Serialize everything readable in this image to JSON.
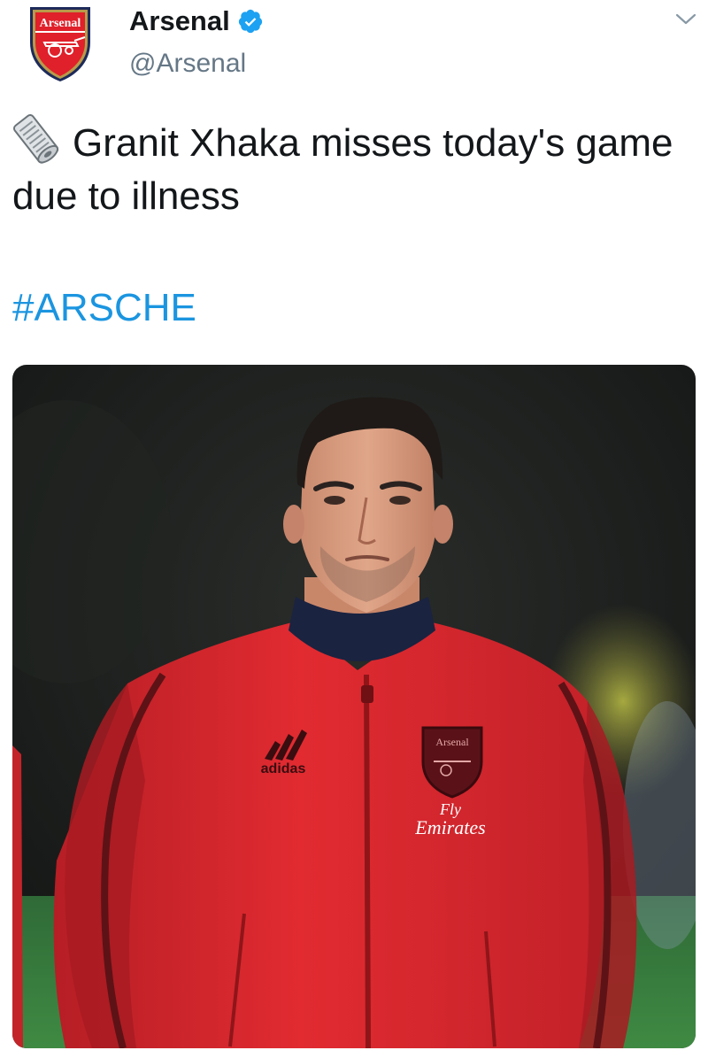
{
  "author": {
    "display_name": "Arsenal",
    "handle": "@Arsenal",
    "verified": true,
    "avatar_crest_text": "Arsenal",
    "avatar_icon": "arsenal-crest-icon"
  },
  "tweet": {
    "text": "Granit Xhaka misses today's game due to illness",
    "emoji_icon": "rolled-newspaper-icon",
    "hashtag": "#ARSCHE"
  },
  "media": {
    "description_icon": "player-photo",
    "jacket_brand_text": "adidas",
    "jacket_crest_text": "Arsenal",
    "sponsor_line1": "Fly",
    "sponsor_line2": "Emirates"
  },
  "colors": {
    "text": "#14171a",
    "secondary": "#657786",
    "link": "#1b95e0",
    "verified": "#1da1f2",
    "jacket_red": "#d9282f"
  }
}
